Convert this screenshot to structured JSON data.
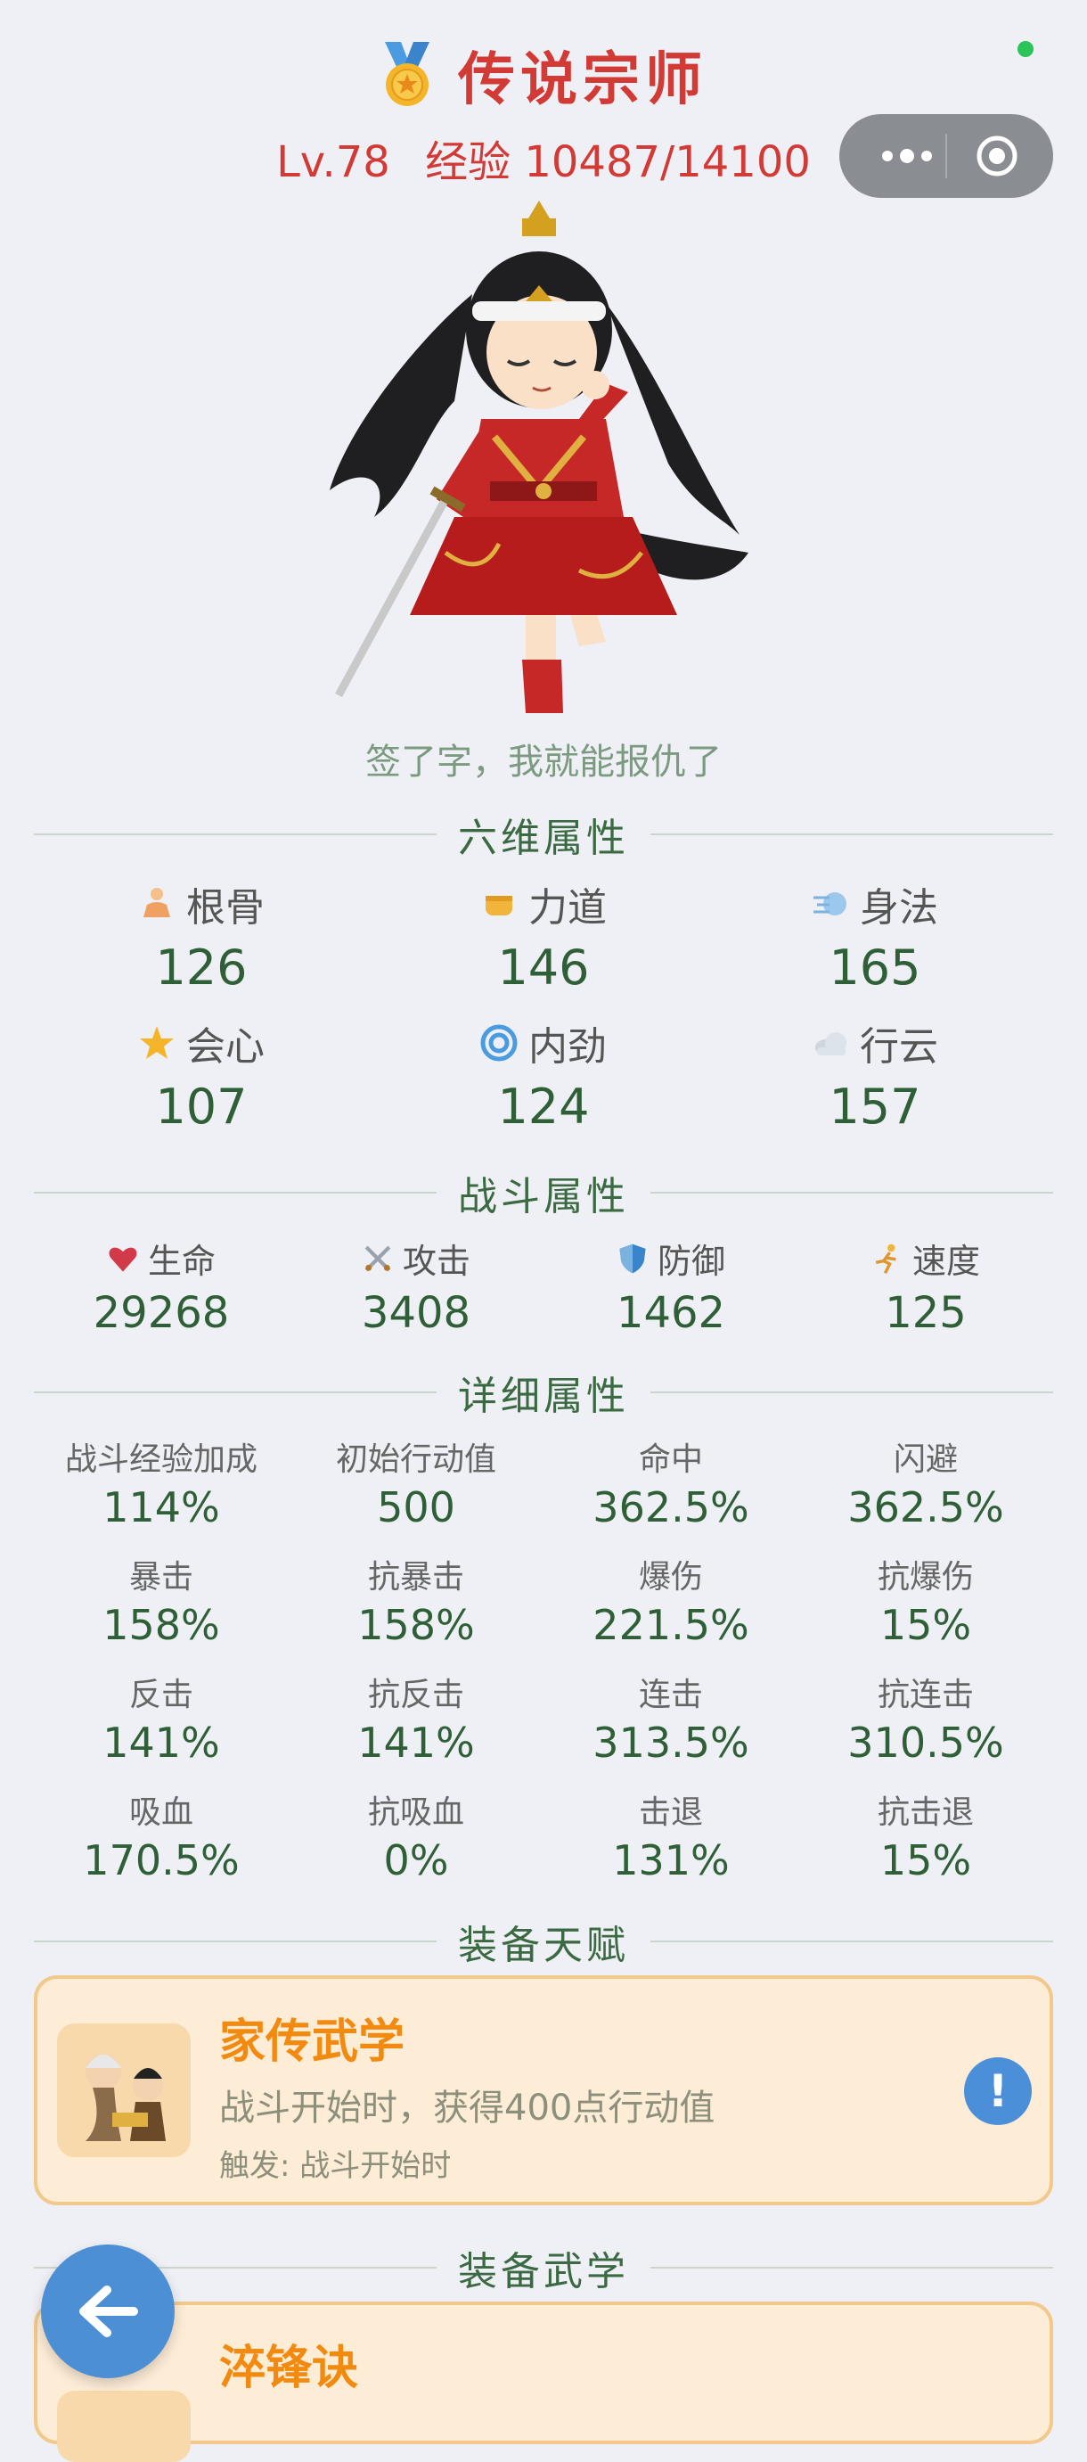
{
  "header": {
    "rank_title": "传说宗师",
    "level": "Lv.78",
    "exp": "经验 10487/14100",
    "quote": "签了字，我就能报仇了"
  },
  "sections": {
    "six": "六维属性",
    "combat": "战斗属性",
    "detail": "详细属性",
    "talent": "装备天赋",
    "martial": "装备武学"
  },
  "six_attrs": [
    {
      "icon": "meditate-icon",
      "label": "根骨",
      "value": "126"
    },
    {
      "icon": "fist-icon",
      "label": "力道",
      "value": "146"
    },
    {
      "icon": "wind-icon",
      "label": "身法",
      "value": "165"
    },
    {
      "icon": "star-icon",
      "label": "会心",
      "value": "107"
    },
    {
      "icon": "swirl-icon",
      "label": "内劲",
      "value": "124"
    },
    {
      "icon": "cloud-icon",
      "label": "行云",
      "value": "157"
    }
  ],
  "combat_attrs": [
    {
      "icon": "heart-icon",
      "label": "生命",
      "value": "29268"
    },
    {
      "icon": "swords-icon",
      "label": "攻击",
      "value": "3408"
    },
    {
      "icon": "shield-icon",
      "label": "防御",
      "value": "1462"
    },
    {
      "icon": "runner-icon",
      "label": "速度",
      "value": "125"
    }
  ],
  "detail_attrs": [
    {
      "label": "战斗经验加成",
      "value": "114%"
    },
    {
      "label": "初始行动值",
      "value": "500"
    },
    {
      "label": "命中",
      "value": "362.5%"
    },
    {
      "label": "闪避",
      "value": "362.5%"
    },
    {
      "label": "暴击",
      "value": "158%"
    },
    {
      "label": "抗暴击",
      "value": "158%"
    },
    {
      "label": "爆伤",
      "value": "221.5%"
    },
    {
      "label": "抗爆伤",
      "value": "15%"
    },
    {
      "label": "反击",
      "value": "141%"
    },
    {
      "label": "抗反击",
      "value": "141%"
    },
    {
      "label": "连击",
      "value": "313.5%"
    },
    {
      "label": "抗连击",
      "value": "310.5%"
    },
    {
      "label": "吸血",
      "value": "170.5%"
    },
    {
      "label": "抗吸血",
      "value": "0%"
    },
    {
      "label": "击退",
      "value": "131%"
    },
    {
      "label": "抗击退",
      "value": "15%"
    }
  ],
  "talent": {
    "name": "家传武学",
    "desc": "战斗开始时，获得400点行动值",
    "trigger": "触发: 战斗开始时",
    "info": "!"
  },
  "martial": {
    "name": "淬锋诀",
    "desc": "every-line-partially-hidden"
  },
  "colors": {
    "title_red": "#d23a36",
    "green_text": "#2f5f36",
    "card_bg": "#fdecd6",
    "accent_orange": "#f28a0f",
    "info_blue": "#4b8fd8"
  }
}
